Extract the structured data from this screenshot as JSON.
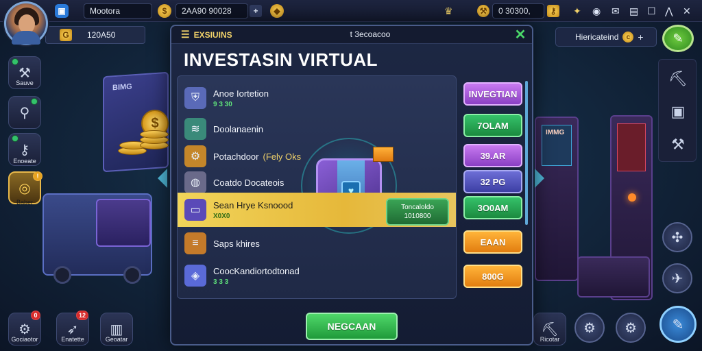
{
  "topbar": {
    "player_name": "Mootora",
    "currency_value": "2AA90 90028",
    "gems_value": "0 30300,",
    "icons": {
      "profile": "square-profile-icon",
      "coin": "gold-coin-icon",
      "add": "plus-icon",
      "token": "token-icon",
      "trophy": "trophy-icon",
      "wrench": "wrench-icon",
      "key": "key-icon",
      "gift": "gift-icon",
      "globe": "globe-icon",
      "mail": "mail-icon",
      "window": "window-icon",
      "signal": "signal-icon"
    }
  },
  "left_pill": {
    "value": "120A50"
  },
  "right_pill": {
    "label": "Hiericateind"
  },
  "left_nav": [
    {
      "label": "Sauve",
      "badge": ""
    },
    {
      "label": "",
      "badge": ""
    },
    {
      "label": "Enoeate",
      "badge": ""
    },
    {
      "label": "Baber",
      "badge": ""
    }
  ],
  "bottom_left_nav": [
    {
      "label": "Gociaotor",
      "badge": "0"
    },
    {
      "label": "Enatette",
      "badge": "12"
    },
    {
      "label": "Geoatar",
      "badge": ""
    }
  ],
  "bottom_right_nav": [
    {
      "label": "Ricotar"
    }
  ],
  "scene": {
    "board_label": "BIMG",
    "server_label": "IMMG"
  },
  "modal": {
    "tab_label": "EXSIUINS",
    "subtitle": "t 3ecoacoo",
    "title": "INVESTASIN VIRTUAL",
    "items": [
      {
        "name": "Anoe Iortetion",
        "sub": "9 3 30",
        "icon": "shield-icon",
        "color": "#5a6ab8"
      },
      {
        "name": "Doolanaenin",
        "sub": "",
        "icon": "stack-icon",
        "color": "#3a8a7a"
      },
      {
        "name": "Potachdoor",
        "sub": "",
        "extra": "(Fely Oks",
        "icon": "gear-icon",
        "color": "#c4862a"
      },
      {
        "name": "Coatdo Docateois",
        "sub": "",
        "icon": "disc-icon",
        "color": "#6a6a8a"
      },
      {
        "name": "Sean Hrye Ksnoood",
        "sub": "X0X0",
        "icon": "chest-icon",
        "color": "#5a4ab8",
        "highlight": true,
        "button_line1": "Toncaloldo",
        "button_line2": "1010800"
      },
      {
        "name": "Saps khires",
        "sub": "",
        "icon": "bars-icon",
        "color": "#c47a2a"
      },
      {
        "name": "CoocKandiortodtonad",
        "sub": "3 3 3",
        "icon": "cube-icon",
        "color": "#5a6ad8"
      }
    ],
    "prices": [
      {
        "label": "INVEGTIAN",
        "style": "purple"
      },
      {
        "label": "7OLAM",
        "style": "green"
      },
      {
        "label": "39.AR",
        "style": "purple"
      },
      {
        "label": "32 PG",
        "style": "blue"
      },
      {
        "label": "3O0AM",
        "style": "green"
      },
      {
        "label": "EAAN",
        "style": "orange"
      },
      {
        "label": "800G",
        "style": "orange"
      }
    ],
    "cta_label": "NEGCAAN"
  },
  "colors": {
    "accent_gold": "#f2d36a",
    "highlight": "#f1d45a",
    "close": "#4bd86a"
  }
}
